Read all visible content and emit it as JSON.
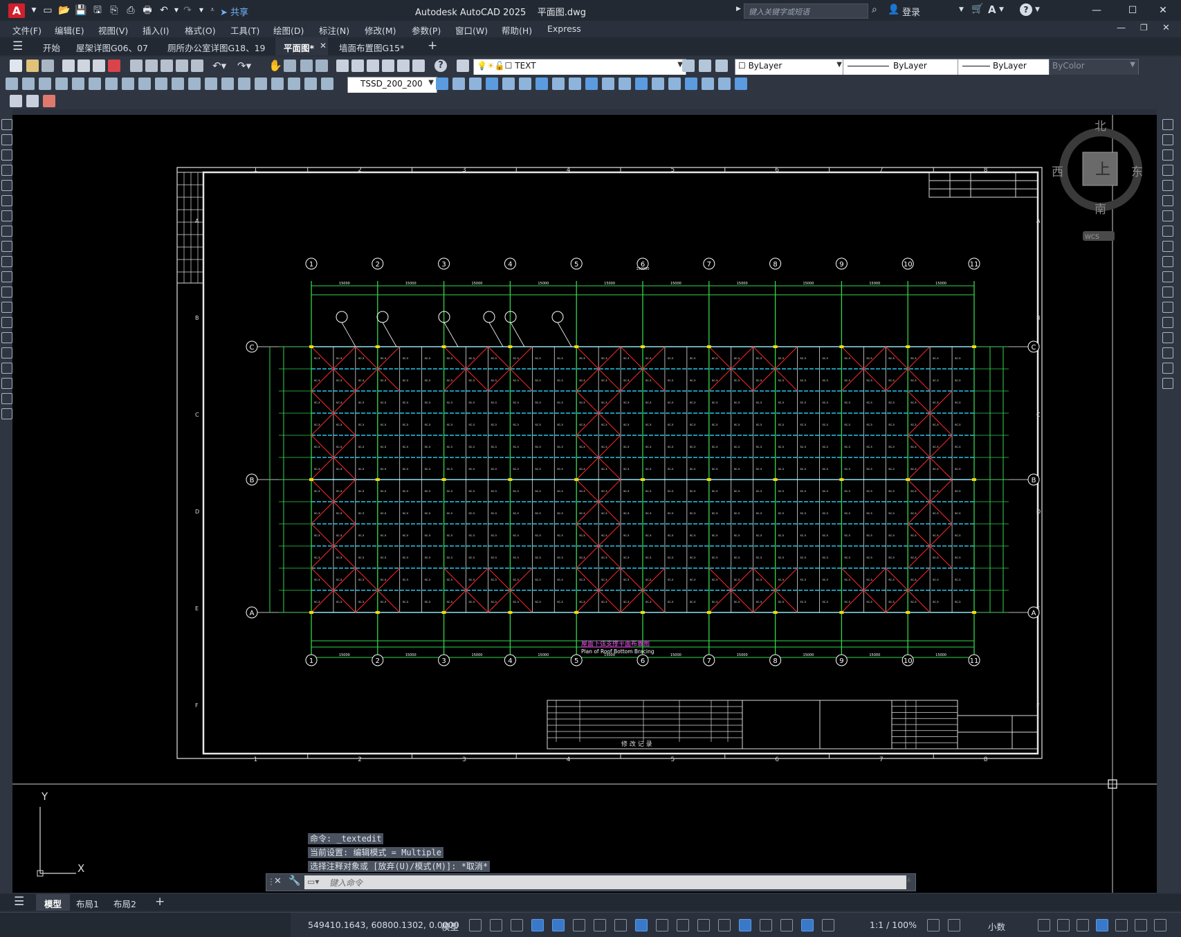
{
  "titlebar": {
    "app_logo": "A",
    "share_label": "共享",
    "title": "Autodesk AutoCAD 2025    平面图.dwg",
    "search_placeholder": "键入关键字或短语",
    "login_label": "登录",
    "minimize": "—",
    "maximize": "☐",
    "close": "✕"
  },
  "menubar": {
    "items": [
      "文件(F)",
      "编辑(E)",
      "视图(V)",
      "插入(I)",
      "格式(O)",
      "工具(T)",
      "绘图(D)",
      "标注(N)",
      "修改(M)",
      "参数(P)",
      "窗口(W)",
      "帮助(H)",
      "Express"
    ]
  },
  "tabs": {
    "items": [
      "开始",
      "屋架详图G06、07",
      "厕所办公室详图G18、19",
      "平面图*",
      "墙面布置图G15*"
    ],
    "active_index": 3,
    "add_label": "+"
  },
  "toolbar": {
    "text_style": "TEXT",
    "layer_color": "ByLayer",
    "linetype": "ByLayer",
    "lineweight": "ByLayer",
    "plot_style": "ByColor",
    "dim_style": "TSSD_200_200"
  },
  "viewcube": {
    "north": "北",
    "south": "南",
    "east": "东",
    "west": "西",
    "top": "上",
    "wcs": "WCS"
  },
  "drawing": {
    "title_cn": "屋面下弦支撑平面布置图",
    "title_en": "Plan of Roof Bottom Bracing",
    "grid_columns": [
      "1",
      "2",
      "3",
      "4",
      "5",
      "6",
      "7",
      "8",
      "9",
      "10",
      "11"
    ],
    "grid_rows": [
      "C",
      "B",
      "A"
    ],
    "frame_columns": [
      "1",
      "2",
      "3",
      "4",
      "5",
      "6",
      "7",
      "8"
    ],
    "frame_rows": [
      "A",
      "B",
      "C",
      "D",
      "E",
      "F"
    ],
    "revision_label": "修  改  记  录",
    "brace_label": "SC-3",
    "span_label": "15000",
    "span_total": "150000"
  },
  "ucs": {
    "y_label": "Y",
    "x_label": "X"
  },
  "command": {
    "history": [
      "命令: _textedit",
      "当前设置: 编辑模式 = Multiple",
      "选择注释对象或 [放弃(U)/模式(M)]: *取消*"
    ],
    "placeholder": "键入命令"
  },
  "layout_tabs": {
    "items": [
      "模型",
      "布局1",
      "布局2"
    ],
    "active_index": 0,
    "add_label": "+"
  },
  "status": {
    "coordinates": "549410.1643, 60800.1302, 0.0000",
    "model_label": "模型",
    "scale": "1:1 / 100%",
    "units": "小数"
  }
}
